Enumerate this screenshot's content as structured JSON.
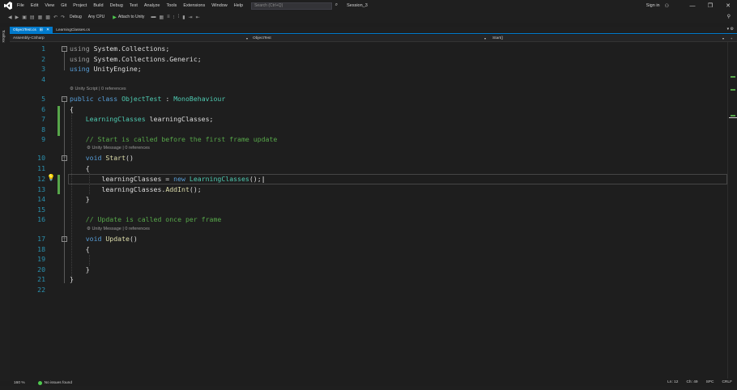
{
  "menubar": {
    "items": [
      "File",
      "Edit",
      "View",
      "Git",
      "Project",
      "Build",
      "Debug",
      "Test",
      "Analyze",
      "Tools",
      "Extensions",
      "Window",
      "Help"
    ],
    "search_placeholder": "Search (Ctrl+Q)",
    "session": "Session_3",
    "signin": "Sign in",
    "window_buttons": [
      "—",
      "❐",
      "✕"
    ]
  },
  "toolbar": {
    "config": "Debug",
    "platform": "Any CPU",
    "attach": "Attach to Unity"
  },
  "left_strip": {
    "label": "Toolbox"
  },
  "tabs": [
    {
      "label": "ObjectTest.cs",
      "close": "✕",
      "pin": "⊞"
    },
    {
      "label": "LearningClasses.cs"
    }
  ],
  "navbar": {
    "project": "Assembly-CSharp",
    "class": "ObjectTest",
    "member": "Start()"
  },
  "editor": {
    "lines": [
      {
        "n": "1"
      },
      {
        "n": "2"
      },
      {
        "n": "3"
      },
      {
        "n": "4"
      },
      {
        "n": "5"
      },
      {
        "n": "6"
      },
      {
        "n": "7"
      },
      {
        "n": "8"
      },
      {
        "n": "9"
      },
      {
        "n": "10"
      },
      {
        "n": "11"
      },
      {
        "n": "12"
      },
      {
        "n": "13"
      },
      {
        "n": "14"
      },
      {
        "n": "15"
      },
      {
        "n": "16"
      },
      {
        "n": "17"
      },
      {
        "n": "18"
      },
      {
        "n": "19"
      },
      {
        "n": "20"
      },
      {
        "n": "21"
      },
      {
        "n": "22"
      }
    ],
    "code": {
      "l1_kw": "using",
      "l1_rest": " System.Collections;",
      "l2_kw": "using",
      "l2_rest": " System.Collections.Generic;",
      "l3_kw": "using",
      "l3_rest": " UnityEngine;",
      "l5_kw1": "public",
      "l5_kw2": "class",
      "l5_cls": "ObjectTest",
      "l5_sep": " : ",
      "l5_base": "MonoBehaviour",
      "l6": "{",
      "l7_type": "LearningClasses",
      "l7_rest": " learningClasses;",
      "l9_comment": "// Start is called before the first frame update",
      "l10_kw": "void",
      "l10_name": "Start",
      "l10_rest": "()",
      "l11": "{",
      "l12_pre": "learningClasses = ",
      "l12_kw": "new",
      "l12_type": "LearningClasses",
      "l12_rest": "();",
      "l13_pre": "learningClasses.",
      "l13_method": "AddInt",
      "l13_rest": "();",
      "l14": "}",
      "l16_comment": "// Update is called once per frame",
      "l17_kw": "void",
      "l17_name": "Update",
      "l17_rest": "()",
      "l18": "{",
      "l20": "}",
      "l21": "}"
    },
    "codelens": {
      "class_lens": "⚙ Unity Script | 0 references",
      "start_lens": "⚙ Unity Message | 0 references",
      "update_lens": "⚙ Unity Message | 0 references"
    }
  },
  "status": {
    "zoom": "160 %",
    "issues": "No issues found",
    "position": "Ln: 12",
    "column": "Ch: 49",
    "whitespace": "SPC",
    "line_ending": "CRLF"
  },
  "colors": {
    "accent": "#007acc",
    "keyword": "#569cd6",
    "type": "#4ec9b0",
    "comment": "#57a64a",
    "method": "#dcdcaa",
    "line_number": "#2b91af"
  }
}
